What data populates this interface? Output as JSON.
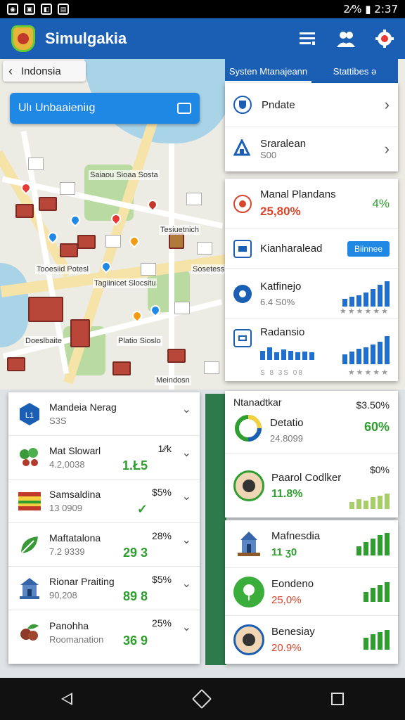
{
  "statusbar": {
    "right": "2⁄% ▮ 2:37"
  },
  "app": {
    "title": "Simulgakia"
  },
  "breadcrumb": {
    "label": "Indonsia"
  },
  "search": {
    "label": "Ulı Unbaaieniıg"
  },
  "map": {
    "labels": [
      "Saiaou Sioaa Sosta",
      "Tesiuetnich",
      "Tooesiid Potesl",
      "Tagiinicet Slocsitu",
      "Sosetess",
      "Doeslbaite",
      "Platio Sioslo",
      "Meindosn"
    ]
  },
  "tabs": [
    {
      "label": "Systen Mtanajeann",
      "active": true
    },
    {
      "label": "Stattibes ə",
      "active": false
    }
  ],
  "right_list": [
    {
      "title": "Pndate",
      "subtitle": ""
    },
    {
      "title": "Sraralean",
      "subtitle": "S00"
    }
  ],
  "stats": [
    {
      "title": "Manal Plandans",
      "value": "25,80%",
      "extra": "4%",
      "value_color": "#d9452b",
      "extra_color": "#2e9e2e"
    },
    {
      "title": "Kianharalead",
      "badge": "Biinnee"
    },
    {
      "title": "Katfinejo",
      "value": "6.4 S0%",
      "dots": "★★★★★★",
      "bars": [
        0.3,
        0.4,
        0.45,
        0.55,
        0.7,
        0.85,
        1.0
      ]
    },
    {
      "title": "Radansio",
      "value": "S 8 3S 08",
      "bars_left": [
        0.6,
        0.8,
        0.5,
        0.7,
        0.6,
        0.5,
        0.55,
        0.5
      ],
      "bars": [
        0.35,
        0.45,
        0.55,
        0.6,
        0.7,
        0.8,
        1.0
      ],
      "dots_left": "★ ★ ★ ★ ★",
      "dots": "★★★★★"
    }
  ],
  "left_list": [
    {
      "name": "Mandeia Nerag",
      "sub": "S3S",
      "pct": "",
      "val": ""
    },
    {
      "name": "Mat Slowarl",
      "sub": "4.2,0038",
      "pct": "1⁄⁄k",
      "val": "1.Ł5"
    },
    {
      "name": "Samsaldina",
      "sub": "13 0909",
      "pct": "$5%",
      "val": "✓"
    },
    {
      "name": "Maftatalona",
      "sub": "7.2 9339",
      "pct": "28%",
      "val": "29 3"
    },
    {
      "name": "Rionar Praiting",
      "sub": "90,208",
      "pct": "$5%",
      "val": "89 8"
    },
    {
      "name": "Panohha",
      "sub": "Roomanation",
      "pct": "25%",
      "val": "36 9"
    }
  ],
  "right_lower": [
    {
      "title": "Ntanadtkar",
      "sub_title": "Detatio",
      "sub": "24.8099",
      "pct": "$3.50%",
      "val": "60%"
    },
    {
      "title": "Paarol Codlker",
      "val": "11.8%",
      "pct": "$0%",
      "bars": [
        0.4,
        0.6,
        0.5,
        0.7,
        0.8,
        0.9
      ]
    }
  ],
  "right_lower2": [
    {
      "title": "Mafnesdia",
      "val": "11 ʒ0",
      "bars": [
        0.4,
        0.6,
        0.75,
        0.9,
        1.0
      ]
    },
    {
      "title": "Eondeno",
      "val": "25,0%",
      "bars": [
        0.5,
        0.7,
        0.85,
        1.0
      ]
    },
    {
      "title": "Benesiay",
      "val": "20.9%",
      "bars": [
        0.6,
        0.8,
        0.9,
        1.0
      ]
    }
  ]
}
